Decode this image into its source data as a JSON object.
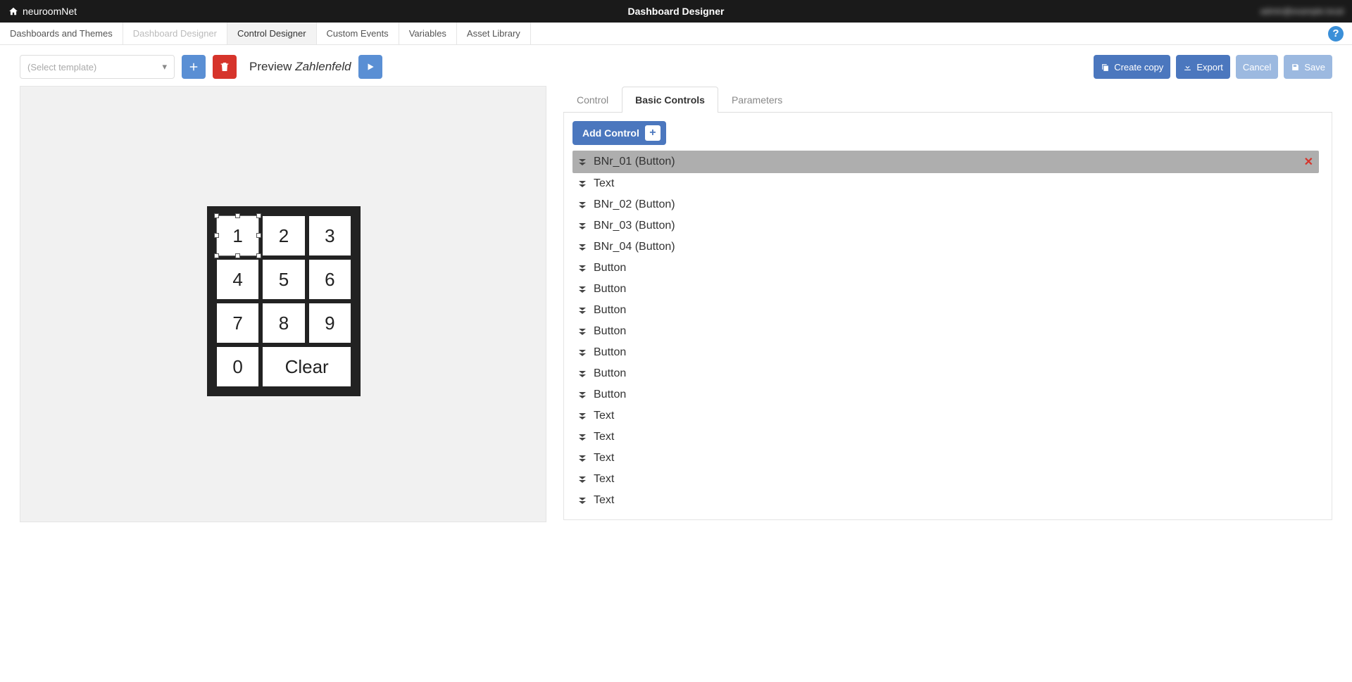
{
  "brand": "neuroomNet",
  "page_title": "Dashboard Designer",
  "user_label": "admin@example.local",
  "menu": [
    {
      "label": "Dashboards and Themes",
      "state": ""
    },
    {
      "label": "Dashboard Designer",
      "state": "disabled"
    },
    {
      "label": "Control Designer",
      "state": "active"
    },
    {
      "label": "Custom Events",
      "state": ""
    },
    {
      "label": "Variables",
      "state": ""
    },
    {
      "label": "Asset Library",
      "state": ""
    }
  ],
  "template_placeholder": "(Select template)",
  "preview_prefix": "Preview ",
  "preview_name": "Zahlenfeld",
  "actions": {
    "create_copy": "Create copy",
    "export": "Export",
    "cancel": "Cancel",
    "save": "Save"
  },
  "keypad": [
    "1",
    "2",
    "3",
    "4",
    "5",
    "6",
    "7",
    "8",
    "9",
    "0",
    "Clear"
  ],
  "keypad_selected_index": 0,
  "side_tabs": [
    {
      "label": "Control",
      "active": false
    },
    {
      "label": "Basic Controls",
      "active": true
    },
    {
      "label": "Parameters",
      "active": false
    }
  ],
  "add_control_label": "Add Control",
  "controls": [
    {
      "label": "BNr_01 (Button)",
      "selected": true
    },
    {
      "label": "Text"
    },
    {
      "label": "BNr_02 (Button)"
    },
    {
      "label": "BNr_03 (Button)"
    },
    {
      "label": "BNr_04 (Button)"
    },
    {
      "label": "Button"
    },
    {
      "label": "Button"
    },
    {
      "label": "Button"
    },
    {
      "label": "Button"
    },
    {
      "label": "Button"
    },
    {
      "label": "Button"
    },
    {
      "label": "Button"
    },
    {
      "label": "Text"
    },
    {
      "label": "Text"
    },
    {
      "label": "Text"
    },
    {
      "label": "Text"
    },
    {
      "label": "Text"
    }
  ]
}
